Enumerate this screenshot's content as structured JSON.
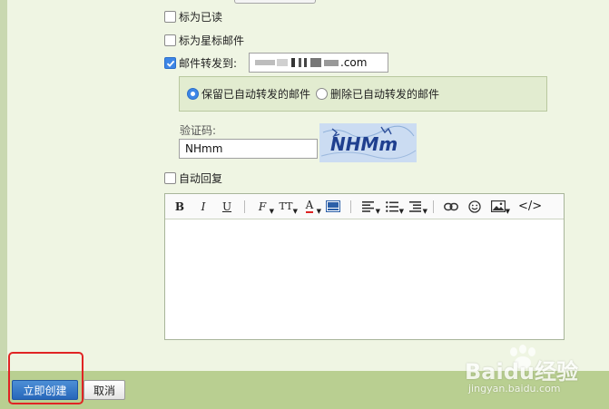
{
  "options": {
    "mark_read": "标为已读",
    "mark_star": "标为星标邮件",
    "forward_to": "邮件转发到:",
    "forward_address_visible": ".com"
  },
  "forward_mode": {
    "keep_label": "保留已自动转发的邮件",
    "delete_label": "删除已自动转发的邮件",
    "selected": "keep"
  },
  "captcha": {
    "label": "验证码:",
    "value": "NHmm",
    "image_text": "NHMm"
  },
  "auto_reply": {
    "label": "自动回复"
  },
  "editor_toolbar": {
    "bold": "B",
    "italic": "I",
    "underline": "U",
    "font": "F",
    "font_size": "TT",
    "font_color": "A"
  },
  "actions": {
    "create": "立即创建",
    "cancel": "取消"
  },
  "watermark": {
    "brand": "Baidu经验",
    "url": "jingyan.baidu.com"
  },
  "colors": {
    "page_bg": "#eff5e3",
    "bottom_bar": "#b9cf91",
    "primary_button": "#2767ba",
    "highlight": "#e02424"
  }
}
